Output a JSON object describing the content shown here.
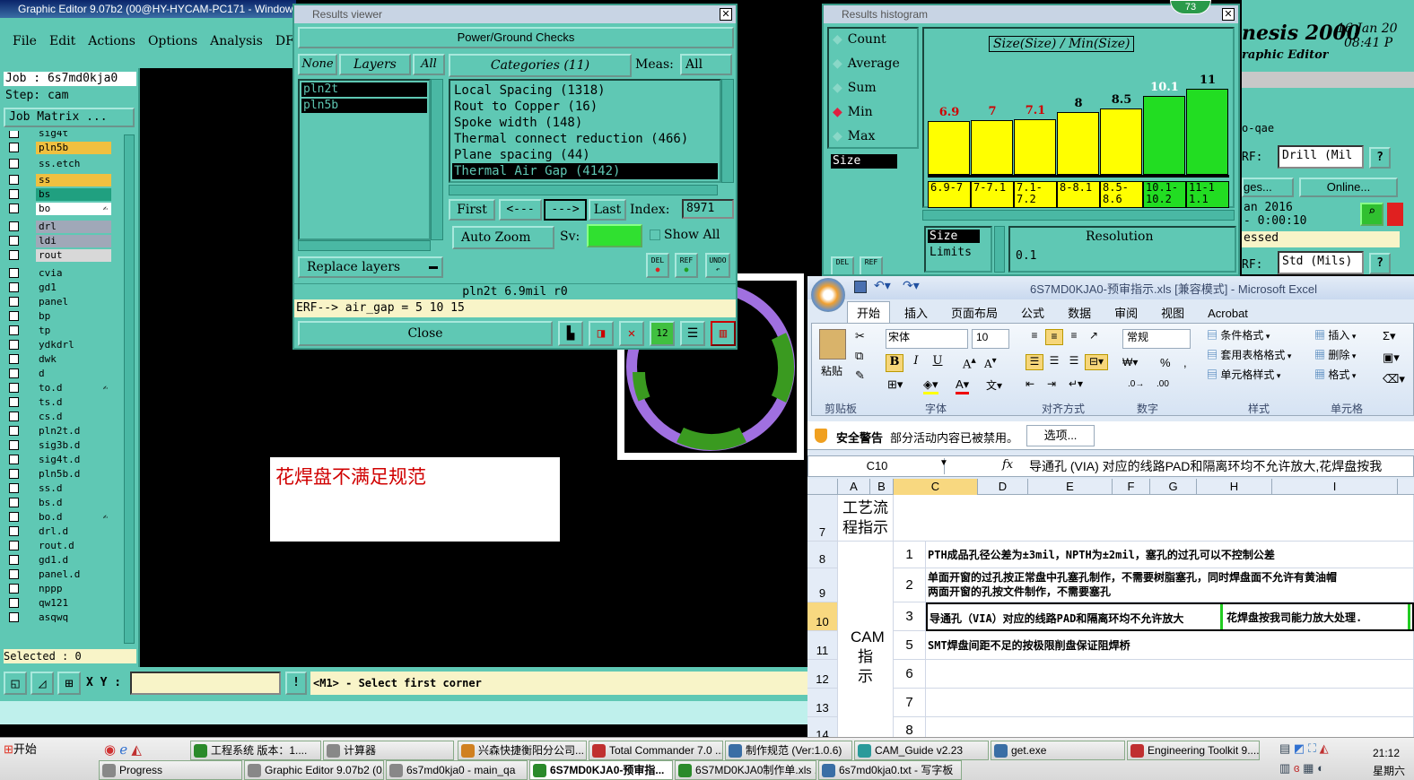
{
  "main_window": {
    "title": "Graphic Editor 9.07b2 (00@HY-HYCAM-PC171 - Window",
    "menu": [
      "File",
      "Edit",
      "Actions",
      "Options",
      "Analysis",
      "DFM"
    ],
    "job_label": "Job : 6s7md0kja0",
    "step_label": "Step: cam",
    "job_matrix": "Job Matrix ...",
    "layers": [
      {
        "name": "sig4t",
        "color": "#5fc8b4"
      },
      {
        "name": "pln5b",
        "color": "#f0c040"
      },
      {
        "name": "ss.etch",
        "color": "#5fc8b4"
      },
      {
        "name": "ss",
        "color": "#f0c040"
      },
      {
        "name": "bs",
        "color": "#20a080"
      },
      {
        "name": "bo",
        "color": "#ffffff",
        "mark": "✍"
      },
      {
        "name": "drl",
        "color": "#a0a8b8"
      },
      {
        "name": "ldi",
        "color": "#a0a8b8"
      },
      {
        "name": "rout",
        "color": "#d8d8d8"
      },
      {
        "name": "cvia",
        "color": "#5fc8b4"
      },
      {
        "name": "gd1",
        "color": "#5fc8b4"
      },
      {
        "name": "panel",
        "color": "#5fc8b4"
      },
      {
        "name": "bp",
        "color": "#5fc8b4"
      },
      {
        "name": "tp",
        "color": "#5fc8b4"
      },
      {
        "name": "ydkdrl",
        "color": "#5fc8b4"
      },
      {
        "name": "dwk",
        "color": "#5fc8b4"
      },
      {
        "name": "d",
        "color": "#5fc8b4"
      },
      {
        "name": "to.d",
        "color": "#5fc8b4",
        "mark": "✍"
      },
      {
        "name": "ts.d",
        "color": "#5fc8b4"
      },
      {
        "name": "cs.d",
        "color": "#5fc8b4"
      },
      {
        "name": "pln2t.d",
        "color": "#5fc8b4"
      },
      {
        "name": "sig3b.d",
        "color": "#5fc8b4"
      },
      {
        "name": "sig4t.d",
        "color": "#5fc8b4"
      },
      {
        "name": "pln5b.d",
        "color": "#5fc8b4"
      },
      {
        "name": "ss.d",
        "color": "#5fc8b4"
      },
      {
        "name": "bs.d",
        "color": "#5fc8b4"
      },
      {
        "name": "bo.d",
        "color": "#5fc8b4",
        "mark": "✍"
      },
      {
        "name": "drl.d",
        "color": "#5fc8b4"
      },
      {
        "name": "rout.d",
        "color": "#5fc8b4"
      },
      {
        "name": "gd1.d",
        "color": "#5fc8b4"
      },
      {
        "name": "panel.d",
        "color": "#5fc8b4"
      },
      {
        "name": "nppp",
        "color": "#5fc8b4"
      },
      {
        "name": "qw121",
        "color": "#5fc8b4"
      },
      {
        "name": "asqwq",
        "color": "#5fc8b4"
      }
    ],
    "selected": "Selected : 0",
    "xy_label": "X Y :",
    "xy_value": "",
    "prompt": "<M1> - Select first corner",
    "annotation": "花焊盘不满足规范",
    "genesis_title": "nesis 2000",
    "genesis_sub": "raphic Editor",
    "date": "16 Jan 20",
    "time": "08:41 P",
    "right_labels": {
      "qae": "o-qae",
      "erf1": "RF:",
      "drill": "Drill (Mil",
      "ges": "ges...",
      "online": "Online...",
      "date2": "an 2016",
      "timer": "- 0:00:10",
      "essed": "essed",
      "erf2": "RF:",
      "std": "Std (Mils)",
      "q": "?"
    }
  },
  "results_viewer": {
    "title": "Results viewer",
    "header": "Power/Ground Checks",
    "none_btn": "None",
    "layers_btn": "Layers",
    "all_btn": "All",
    "layer_items": [
      "pln2t",
      "pln5b"
    ],
    "categories_btn": "Categories (11)",
    "meas_label": "Meas:",
    "meas_value": "All",
    "categories": [
      "Local Spacing (1318)",
      "Rout to Copper (16)",
      "Spoke width (148)",
      "Thermal connect reduction (466)",
      "Plane spacing (44)",
      "Thermal Air Gap (4142)"
    ],
    "first": "First",
    "prev": "<---",
    "next": "--->",
    "last": "Last",
    "index_label": "Index:",
    "index_value": "8971",
    "replace_layers": "Replace layers",
    "auto_zoom": "Auto Zoom",
    "sv_label": "Sv:",
    "show_all": "Show All",
    "del": "DEL",
    "ref": "REF",
    "undo": "UNDO",
    "status": "pln2t 6.9mil  r0",
    "erf": "ERF--> air_gap = 5 10 15",
    "close": "Close"
  },
  "histogram": {
    "title": "Results histogram",
    "badge": "73",
    "options": [
      "Count",
      "Average",
      "Sum",
      "Min",
      "Max"
    ],
    "selected_option": "Min",
    "field_label": "Size",
    "chart_title": "Size(Size) / Min(Size)",
    "size_label": "Size",
    "limits_label": "Limits",
    "resolution_label": "Resolution",
    "resolution_value": "0.1",
    "del": "DEL",
    "ref": "REF"
  },
  "chart_data": {
    "type": "bar",
    "title": "Size(Size) / Min(Size)",
    "categories": [
      "6.9-7",
      "7-7.1",
      "7.1-7.2",
      "8-8.1",
      "8.5-8.6",
      "10.1-10.2",
      "11-11.1"
    ],
    "values": [
      6.9,
      7,
      7.1,
      8,
      8.5,
      10.1,
      11
    ],
    "colors": [
      "#ffff00",
      "#ffff00",
      "#ffff00",
      "#ffff00",
      "#ffff00",
      "#22dd22",
      "#22dd22"
    ],
    "label_colors": [
      "#d00000",
      "#d00000",
      "#d00000",
      "#000000",
      "#000000",
      "#ffffff",
      "#000000"
    ],
    "ylim": [
      0,
      11
    ]
  },
  "excel": {
    "title": "6S7MD0KJA0-预审指示.xls [兼容模式] - Microsoft Excel",
    "tabs": [
      "开始",
      "插入",
      "页面布局",
      "公式",
      "数据",
      "审阅",
      "视图",
      "Acrobat"
    ],
    "font_name": "宋体",
    "font_size": "10",
    "number_format": "常规",
    "groups": [
      "剪贴板",
      "字体",
      "对齐方式",
      "数字",
      "样式",
      "单元格"
    ],
    "paste": "粘贴",
    "styles": [
      "条件格式",
      "套用表格格式",
      "单元格样式"
    ],
    "cells_btns": [
      "插入",
      "删除",
      "格式"
    ],
    "security_label": "安全警告",
    "security_text": "部分活动内容已被禁用。",
    "options_btn": "选项...",
    "name_box": "C10",
    "formula": "导通孔 (VIA) 对应的线路PAD和隔离环均不允许放大,花焊盘按我",
    "col_headers": [
      "A",
      "B",
      "C",
      "D",
      "E",
      "F",
      "G",
      "H",
      "I"
    ],
    "row7_label": "工艺流程指示",
    "cam_label": "CAM指示",
    "rows": [
      {
        "row": "8",
        "num": "1",
        "text": "PTH成品孔径公差为±3mil，NPTH为±2mil，塞孔的过孔可以不控制公差"
      },
      {
        "row": "9",
        "num": "2",
        "text": "单面开窗的过孔按正常盘中孔塞孔制作，不需要树脂塞孔，同时焊盘面不允许有黄油帽",
        "text2": "两面开窗的孔按文件制作，不需要塞孔"
      },
      {
        "row": "10",
        "num": "3",
        "text": "导通孔（VIA）对应的线路PAD和隔离环均不允许放大",
        "text_hl": "花焊盘按我司能力放大处理."
      },
      {
        "row": "11",
        "num": "5",
        "text": "SMT焊盘间距不足的按极限削盘保证阻焊桥"
      },
      {
        "row": "12",
        "num": "6",
        "text": ""
      },
      {
        "row": "13",
        "num": "7",
        "text": ""
      },
      {
        "row": "14",
        "num": "8",
        "text": ""
      }
    ]
  },
  "taskbar": {
    "start": "开始",
    "row1": [
      {
        "label": "工程系统  版本：1....",
        "color": "#2a8a2a"
      },
      {
        "label": "计算器",
        "color": "#888"
      },
      {
        "label": "兴森快捷衡阳分公司...",
        "color": "#d08020"
      },
      {
        "label": "Total Commander 7.0 ...",
        "color": "#c03030"
      },
      {
        "label": "制作规范 (Ver:1.0.6)",
        "color": "#3a6ea5"
      },
      {
        "label": "CAM_Guide v2.23",
        "color": "#2a9a9a"
      },
      {
        "label": "get.exe",
        "color": "#3a6ea5"
      },
      {
        "label": "Engineering Toolkit 9....",
        "color": "#c03030"
      }
    ],
    "row2": [
      {
        "label": "Progress",
        "color": "#888"
      },
      {
        "label": "Graphic Editor 9.07b2 (0...",
        "color": "#888"
      },
      {
        "label": "6s7md0kja0 - main_qa",
        "color": "#888"
      },
      {
        "label": "6S7MD0KJA0-预审指...",
        "color": "#2a8a2a"
      },
      {
        "label": "6S7MD0KJA0制作单.xls ...",
        "color": "#2a8a2a"
      },
      {
        "label": "6s7md0kja0.txt - 写字板",
        "color": "#3a6ea5"
      }
    ],
    "clock": "21:12",
    "day": "星期六"
  }
}
